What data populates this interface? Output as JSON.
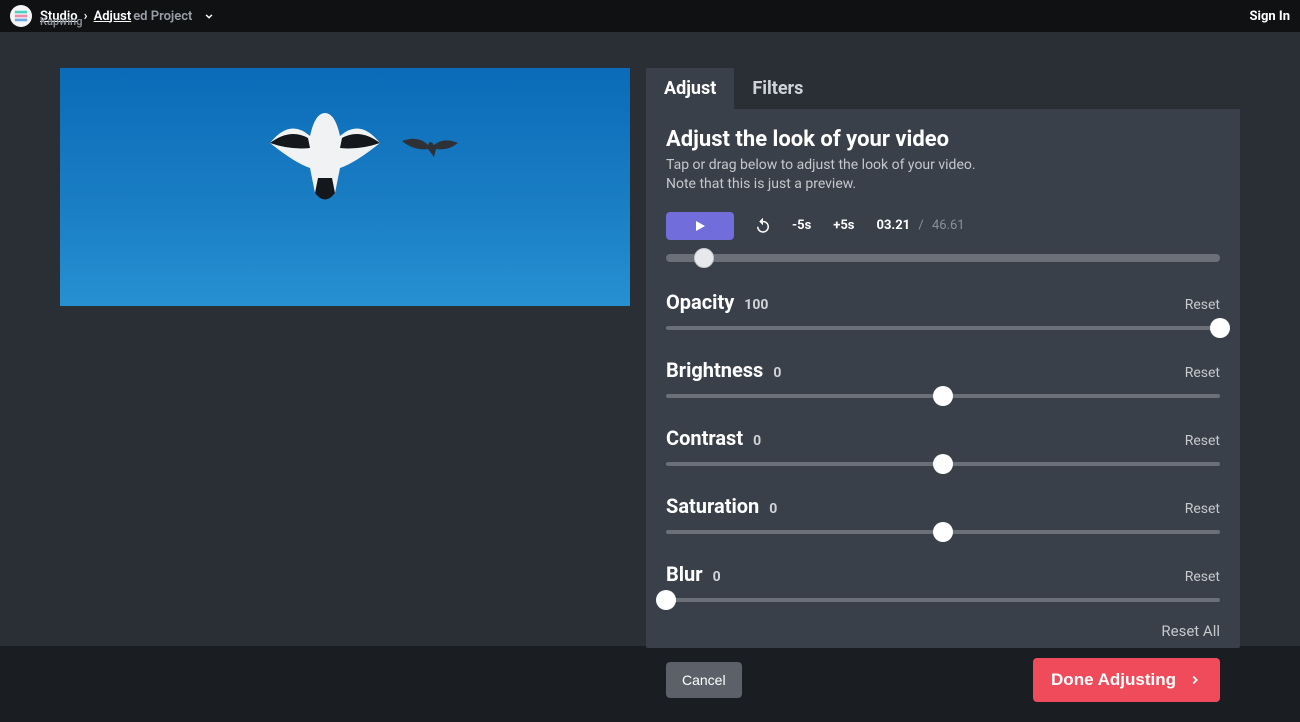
{
  "breadcrumb": {
    "studio": "Studio",
    "adjust": "Adjust",
    "project_overlay": "ed Project",
    "appname": "Kapwing"
  },
  "signin": "Sign In",
  "tabs": {
    "adjust": "Adjust",
    "filters": "Filters",
    "active": "adjust"
  },
  "panel": {
    "heading": "Adjust the look of your video",
    "sub1": "Tap or drag below to adjust the look of your video.",
    "sub2": "Note that this is just a preview."
  },
  "playback": {
    "back5": "-5s",
    "fwd5": "+5s",
    "current": "03.21",
    "total": "46.61",
    "position_pct": 6.9
  },
  "sliders": [
    {
      "name": "Opacity",
      "value": "100",
      "pos_pct": 100,
      "reset": "Reset"
    },
    {
      "name": "Brightness",
      "value": "0",
      "pos_pct": 50,
      "reset": "Reset"
    },
    {
      "name": "Contrast",
      "value": "0",
      "pos_pct": 50,
      "reset": "Reset"
    },
    {
      "name": "Saturation",
      "value": "0",
      "pos_pct": 50,
      "reset": "Reset"
    },
    {
      "name": "Blur",
      "value": "0",
      "pos_pct": 0,
      "reset": "Reset"
    }
  ],
  "reset_all": "Reset All",
  "cancel": "Cancel",
  "done": "Done Adjusting"
}
